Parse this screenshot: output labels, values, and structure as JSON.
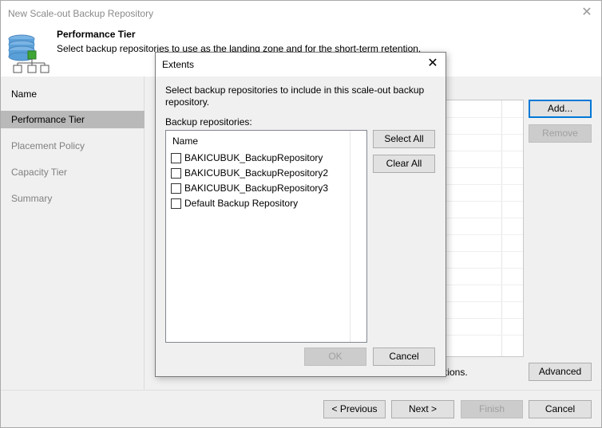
{
  "window": {
    "title": "New Scale-out Backup Repository",
    "close_glyph": "✕"
  },
  "header": {
    "title": "Performance Tier",
    "description": "Select backup repositories to use as the landing zone and for the short-term retention."
  },
  "steps": [
    {
      "label": "Name",
      "state": "done"
    },
    {
      "label": "Performance Tier",
      "state": "active"
    },
    {
      "label": "Placement Policy",
      "state": "pending"
    },
    {
      "label": "Capacity Tier",
      "state": "pending"
    },
    {
      "label": "Summary",
      "state": "pending"
    }
  ],
  "content": {
    "add_label": "Add...",
    "remove_label": "Remove",
    "advanced_label": "Advanced",
    "tail_text": "tions."
  },
  "footer": {
    "previous_label": "< Previous",
    "next_label": "Next >",
    "finish_label": "Finish",
    "cancel_label": "Cancel"
  },
  "dialog": {
    "title": "Extents",
    "close_glyph": "✕",
    "description": "Select backup repositories to include in this scale-out backup repository.",
    "list_label": "Backup repositories:",
    "column_header": "Name",
    "repositories": [
      {
        "name": "BAKICUBUK_BackupRepository",
        "checked": false
      },
      {
        "name": "BAKICUBUK_BackupRepository2",
        "checked": false
      },
      {
        "name": "BAKICUBUK_BackupRepository3",
        "checked": false
      },
      {
        "name": "Default Backup Repository",
        "checked": false
      }
    ],
    "select_all_label": "Select All",
    "clear_all_label": "Clear All",
    "ok_label": "OK",
    "cancel_label": "Cancel"
  },
  "colors": {
    "active_step_bg": "#b9b9b9",
    "focus_border": "#0078d7",
    "icon_blue": "#5aa0d8",
    "icon_green": "#3fa535"
  },
  "icons": {
    "header_icon": "database-hierarchy-icon",
    "close_icon": "close-icon"
  }
}
